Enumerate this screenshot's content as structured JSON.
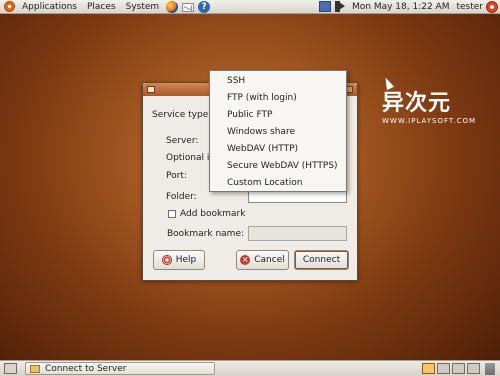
{
  "top_panel": {
    "menus": [
      "Applications",
      "Places",
      "System"
    ],
    "launchers": [
      "firefox-icon",
      "mail-icon",
      "help-icon"
    ],
    "clock": "Mon May 18,  1:22 AM",
    "user": "tester"
  },
  "desktop": {
    "watermark_title": "异次元",
    "watermark_url": "WWW.IPLAYSOFT.COM"
  },
  "dialog": {
    "service_type_label": "Service type:",
    "server_label": "Server:",
    "optional_label": "Optional in",
    "port_label": "Port:",
    "folder_label": "Folder:",
    "add_bookmark_label": "Add bookmark",
    "bookmark_name_label": "Bookmark name:",
    "help_button": "Help",
    "cancel_button": "Cancel",
    "connect_button": "Connect"
  },
  "dropdown": {
    "items": [
      "SSH",
      "FTP (with login)",
      "Public FTP",
      "Windows share",
      "WebDAV (HTTP)",
      "Secure WebDAV (HTTPS)",
      "Custom Location"
    ]
  },
  "bottom_panel": {
    "task_label": "Connect to Server",
    "workspaces": 4,
    "active_workspace": 1
  },
  "colors": {
    "panel": "#e6e2dc",
    "titlebar": "#b86a36",
    "desktop": "#8a4318"
  }
}
